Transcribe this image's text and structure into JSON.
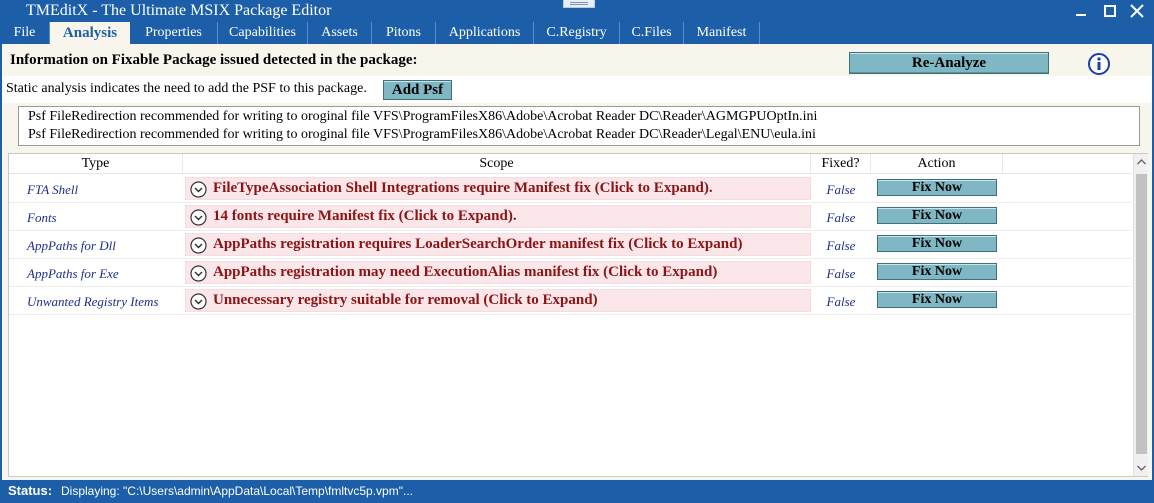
{
  "window": {
    "title": "TMEditX - The Ultimate MSIX Package Editor"
  },
  "tabs": [
    {
      "label": "File"
    },
    {
      "label": "Analysis",
      "active": true
    },
    {
      "label": "Properties"
    },
    {
      "label": "Capabilities"
    },
    {
      "label": "Assets"
    },
    {
      "label": "Pitons"
    },
    {
      "label": "Applications"
    },
    {
      "label": "C.Registry"
    },
    {
      "label": "C.Files"
    },
    {
      "label": "Manifest"
    }
  ],
  "analysis": {
    "info_heading": "Information on Fixable Package issued detected in the package:",
    "reanalyze_label": "Re-Analyze",
    "info_icon": "info-icon",
    "static_text": "Static analysis indicates the need to add the PSF to this package.",
    "add_psf_label": "Add Psf",
    "psf_recommendations": [
      "Psf FileRedirection recommended for writing to oroginal file VFS\\ProgramFilesX86\\Adobe\\Acrobat Reader DC\\Reader\\AGMGPUOptIn.ini",
      "Psf FileRedirection recommended for writing to oroginal file VFS\\ProgramFilesX86\\Adobe\\Acrobat Reader DC\\Reader\\Legal\\ENU\\eula.ini"
    ],
    "grid": {
      "headers": {
        "type": "Type",
        "scope": "Scope",
        "fixed": "Fixed?",
        "action": "Action"
      },
      "rows": [
        {
          "type": "FTA Shell",
          "scope": "FileTypeAssociation Shell Integrations require Manifest fix (Click to Expand).",
          "fixed": "False",
          "action": "Fix Now"
        },
        {
          "type": "Fonts",
          "scope": "14 fonts require Manifest fix (Click to Expand).",
          "fixed": "False",
          "action": "Fix Now"
        },
        {
          "type": "AppPaths for Dll",
          "scope": "AppPaths registration requires LoaderSearchOrder manifest fix (Click to Expand)",
          "fixed": "False",
          "action": "Fix Now"
        },
        {
          "type": "AppPaths for Exe",
          "scope": "AppPaths registration may need ExecutionAlias manifest fix (Click to Expand)",
          "fixed": "False",
          "action": "Fix Now"
        },
        {
          "type": "Unwanted Registry Items",
          "scope": "Unnecessary registry suitable for removal (Click to Expand)",
          "fixed": "False",
          "action": "Fix Now"
        }
      ]
    }
  },
  "status": {
    "label": "Status:",
    "text": "Displaying: \"C:\\Users\\admin\\AppData\\Local\\Temp\\fmltvc5p.vpm\"..."
  },
  "colors": {
    "titlebar": "#1c5fa8",
    "panel_bg": "#f7f5ec",
    "button": "#7fb8c4",
    "scope_bg": "#fbe6ea",
    "scope_text": "#8b1414",
    "link_text": "#1d2f8a"
  }
}
